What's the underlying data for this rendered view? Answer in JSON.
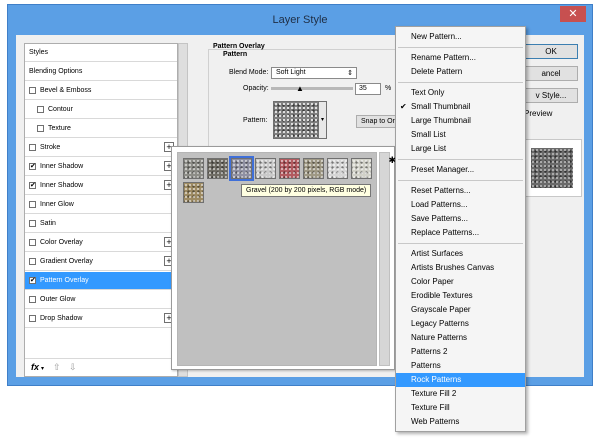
{
  "window": {
    "title": "Layer Style",
    "close_glyph": "✕"
  },
  "styles_panel": {
    "items": [
      {
        "label": "Styles",
        "checkbox": false,
        "checked": false,
        "plus": false,
        "selected": false,
        "indent": false
      },
      {
        "label": "Blending Options",
        "checkbox": false,
        "checked": false,
        "plus": false,
        "selected": false,
        "indent": false
      },
      {
        "label": "Bevel & Emboss",
        "checkbox": true,
        "checked": false,
        "plus": false,
        "selected": false,
        "indent": false
      },
      {
        "label": "Contour",
        "checkbox": true,
        "checked": false,
        "plus": false,
        "selected": false,
        "indent": true
      },
      {
        "label": "Texture",
        "checkbox": true,
        "checked": false,
        "plus": false,
        "selected": false,
        "indent": true
      },
      {
        "label": "Stroke",
        "checkbox": true,
        "checked": false,
        "plus": true,
        "selected": false,
        "indent": false
      },
      {
        "label": "Inner Shadow",
        "checkbox": true,
        "checked": true,
        "plus": true,
        "selected": false,
        "indent": false
      },
      {
        "label": "Inner Shadow",
        "checkbox": true,
        "checked": true,
        "plus": true,
        "selected": false,
        "indent": false
      },
      {
        "label": "Inner Glow",
        "checkbox": true,
        "checked": false,
        "plus": false,
        "selected": false,
        "indent": false
      },
      {
        "label": "Satin",
        "checkbox": true,
        "checked": false,
        "plus": false,
        "selected": false,
        "indent": false
      },
      {
        "label": "Color Overlay",
        "checkbox": true,
        "checked": false,
        "plus": true,
        "selected": false,
        "indent": false
      },
      {
        "label": "Gradient Overlay",
        "checkbox": true,
        "checked": false,
        "plus": true,
        "selected": false,
        "indent": false
      },
      {
        "label": "Pattern Overlay",
        "checkbox": true,
        "checked": true,
        "plus": false,
        "selected": true,
        "indent": false
      },
      {
        "label": "Outer Glow",
        "checkbox": true,
        "checked": false,
        "plus": false,
        "selected": false,
        "indent": false
      },
      {
        "label": "Drop Shadow",
        "checkbox": true,
        "checked": false,
        "plus": true,
        "selected": false,
        "indent": false
      }
    ],
    "fx_label": "fx",
    "fx_dot": "▾",
    "up_glyph": "⇧",
    "down_glyph": "⇩"
  },
  "pattern_overlay": {
    "title": "Pattern Overlay",
    "subtitle": "Pattern",
    "blend_mode_label": "Blend Mode:",
    "blend_mode_value": "Soft Light",
    "opacity_label": "Opacity:",
    "opacity_value": "35",
    "opacity_unit": "%",
    "pattern_label": "Pattern:",
    "snap_label": "Snap to Or",
    "select_arrow": "⇕",
    "drop_arrow": "▾",
    "slider_glyph": "▲"
  },
  "buttons": {
    "ok": "OK",
    "cancel": "ancel",
    "new_style": "v Style..."
  },
  "preview_label": "Preview",
  "picker": {
    "tooltip": "Gravel (200 by 200 pixels, RGB mode)",
    "gear_glyph": "✱",
    "swatches": [
      {
        "name": "swatch-1",
        "color": "#8c8c86",
        "selected": false
      },
      {
        "name": "swatch-2",
        "color": "#6f6c64",
        "selected": false
      },
      {
        "name": "swatch-gravel",
        "color": "#8f90a2",
        "selected": true
      },
      {
        "name": "swatch-4",
        "color": "#c9c9c9",
        "selected": false
      },
      {
        "name": "swatch-5",
        "color": "#b2595e",
        "selected": false
      },
      {
        "name": "swatch-6",
        "color": "#9e9884",
        "selected": false
      },
      {
        "name": "swatch-7",
        "color": "#d6d6d6",
        "selected": false
      },
      {
        "name": "swatch-8",
        "color": "#d1d1c8",
        "selected": false
      },
      {
        "name": "swatch-9",
        "color": "#9d8a62",
        "selected": false
      }
    ]
  },
  "menu": {
    "items": [
      {
        "label": "New Pattern...",
        "sep_after": true
      },
      {
        "label": "Rename Pattern...",
        "sep_after": false
      },
      {
        "label": "Delete Pattern",
        "sep_after": true
      },
      {
        "label": "Text Only",
        "sep_after": false
      },
      {
        "label": "Small Thumbnail",
        "checked": true,
        "sep_after": false
      },
      {
        "label": "Large Thumbnail",
        "sep_after": false
      },
      {
        "label": "Small List",
        "sep_after": false
      },
      {
        "label": "Large List",
        "sep_after": true
      },
      {
        "label": "Preset Manager...",
        "sep_after": true
      },
      {
        "label": "Reset Patterns...",
        "sep_after": false
      },
      {
        "label": "Load Patterns...",
        "sep_after": false
      },
      {
        "label": "Save Patterns...",
        "sep_after": false
      },
      {
        "label": "Replace Patterns...",
        "sep_after": true
      },
      {
        "label": "Artist Surfaces",
        "sep_after": false
      },
      {
        "label": "Artists Brushes Canvas",
        "sep_after": false
      },
      {
        "label": "Color Paper",
        "sep_after": false
      },
      {
        "label": "Erodible Textures",
        "sep_after": false
      },
      {
        "label": "Grayscale Paper",
        "sep_after": false
      },
      {
        "label": "Legacy Patterns",
        "sep_after": false
      },
      {
        "label": "Nature Patterns",
        "sep_after": false
      },
      {
        "label": "Patterns 2",
        "sep_after": false
      },
      {
        "label": "Patterns",
        "sep_after": false
      },
      {
        "label": "Rock Patterns",
        "highlighted": true,
        "sep_after": false
      },
      {
        "label": "Texture Fill 2",
        "sep_after": false
      },
      {
        "label": "Texture Fill",
        "sep_after": false
      },
      {
        "label": "Web Patterns",
        "sep_after": false
      }
    ],
    "check_glyph": "✔"
  },
  "colors": {
    "accent": "#3399ff",
    "title_bar": "#5b9fe5",
    "close": "#c75050"
  }
}
